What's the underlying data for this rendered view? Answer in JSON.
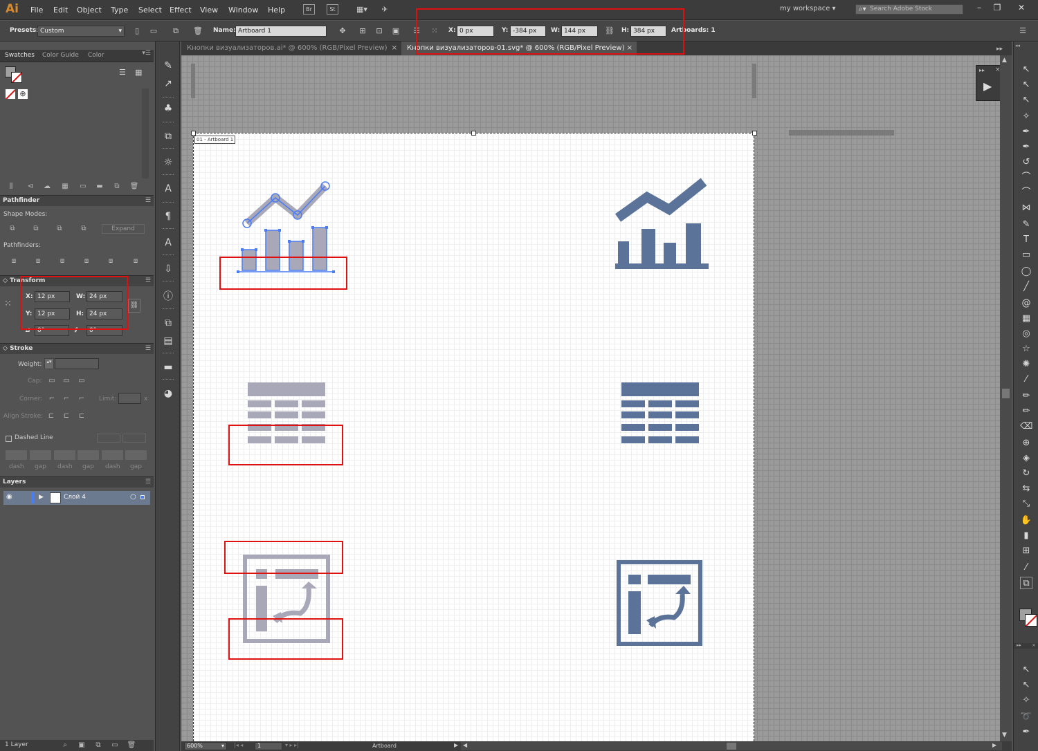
{
  "app": {
    "logo": "Ai",
    "menus": [
      "File",
      "Edit",
      "Object",
      "Type",
      "Select",
      "Effect",
      "View",
      "Window",
      "Help"
    ],
    "bridge_btn": "Br",
    "stock_btn": "St",
    "workspace": "my workspace",
    "search_placeholder": "Search Adobe Stock"
  },
  "control_bar": {
    "presets_label": "Presets:",
    "presets_value": "Custom",
    "name_label": "Name:",
    "name_value": "Artboard 1",
    "x_label": "X:",
    "x_value": "0 px",
    "y_label": "Y:",
    "y_value": "-384 px",
    "w_label": "W:",
    "w_value": "144 px",
    "h_label": "H:",
    "h_value": "384 px",
    "artboards_label": "Artboards: 1"
  },
  "doc_tabs": [
    {
      "label": "Кнопки визуализаторов.ai* @ 600% (RGB/Pixel Preview)",
      "active": false
    },
    {
      "label": "Кнопки визуализаторов-01.svg* @ 600% (RGB/Pixel Preview)",
      "active": true
    }
  ],
  "swatches_panel": {
    "tabs": [
      "Swatches",
      "Color Guide",
      "Color"
    ]
  },
  "pathfinder": {
    "title": "Pathfinder",
    "shape_modes": "Shape Modes:",
    "expand": "Expand",
    "pathfinders": "Pathfinders:"
  },
  "transform": {
    "title": "Transform",
    "x_label": "X:",
    "x": "12 px",
    "y_label": "Y:",
    "y": "12 px",
    "w_label": "W:",
    "w": "24 px",
    "h_label": "H:",
    "h": "24 px",
    "angle": "0°",
    "shear": "0°"
  },
  "stroke": {
    "title": "Stroke",
    "weight": "Weight:",
    "cap": "Cap:",
    "corner": "Corner:",
    "limit": "Limit:",
    "limit_x": "x",
    "align": "Align Stroke:",
    "dashed": "Dashed Line",
    "dash_labels": [
      "dash",
      "gap",
      "dash",
      "gap",
      "dash",
      "gap"
    ]
  },
  "layers": {
    "title": "Layers",
    "layer_name": "Слой 4",
    "count": "1 Layer"
  },
  "artboard": {
    "label": "01 - Artboard 1"
  },
  "status": {
    "zoom": "600%",
    "page": "1",
    "tool": "Artboard"
  },
  "colors": {
    "icon_fill": "#5b7398",
    "icon_fill_light": "#a8a8b8",
    "selection": "#4a7cf2",
    "annotation": "#e01010"
  }
}
